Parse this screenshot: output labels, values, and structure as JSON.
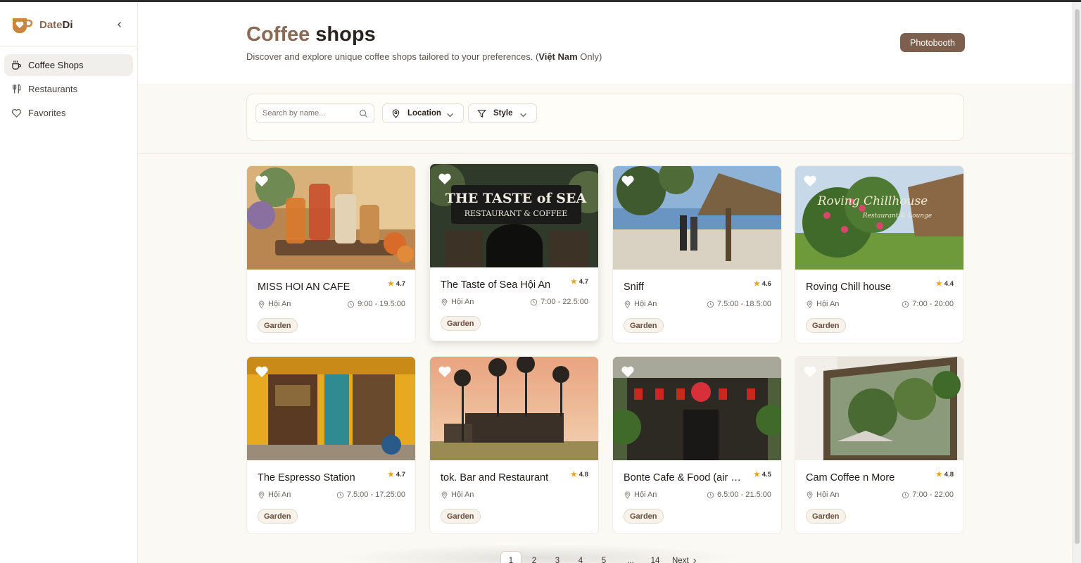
{
  "app": {
    "name_prefix": "Date",
    "name_suffix": "Di"
  },
  "sidebar": {
    "items": [
      {
        "label": "Coffee Shops",
        "icon": "coffee-cup-icon",
        "active": true
      },
      {
        "label": "Restaurants",
        "icon": "utensils-icon",
        "active": false
      },
      {
        "label": "Favorites",
        "icon": "heart-outline-icon",
        "active": false
      }
    ]
  },
  "header": {
    "title_accent": "Coffee",
    "title_rest": " shops",
    "subtitle_pre": "Discover and explore unique coffee shops tailored to your preferences. (",
    "subtitle_bold": "Việt Nam",
    "subtitle_post": " Only)",
    "photobooth_label": "Photobooth"
  },
  "filters": {
    "search_placeholder": "Search by name...",
    "search_value": "",
    "location_label": "Location",
    "style_label": "Style"
  },
  "colors": {
    "accent": "#7d5f4d",
    "star": "#e8a317",
    "tag_text": "#6b4d3b"
  },
  "cards": [
    {
      "name": "MISS HOI AN CAFE",
      "rating": "4.7",
      "location": "Hội An",
      "hours": "9:00 - 19.5:00",
      "tag": "Garden"
    },
    {
      "name": "The Taste of Sea Hội An",
      "rating": "4.7",
      "location": "Hội An",
      "hours": "7:00 - 22.5:00",
      "tag": "Garden"
    },
    {
      "name": "Sniff",
      "rating": "4.6",
      "location": "Hội An",
      "hours": "7.5:00 - 18.5:00",
      "tag": "Garden"
    },
    {
      "name": "Roving Chill house",
      "rating": "4.4",
      "location": "Hội An",
      "hours": "7:00 - 20:00",
      "tag": "Garden"
    },
    {
      "name": "The Espresso Station",
      "rating": "4.7",
      "location": "Hội An",
      "hours": "7.5:00 - 17.25:00",
      "tag": "Garden"
    },
    {
      "name": "tok. Bar and Restaurant",
      "rating": "4.8",
      "location": "Hội An",
      "hours": "",
      "tag": "Garden"
    },
    {
      "name": "Bonte Cafe & Food (air co...",
      "rating": "4.5",
      "location": "Hội An",
      "hours": "6.5:00 - 21.5:00",
      "tag": "Garden"
    },
    {
      "name": "Cam Coffee n More",
      "rating": "4.8",
      "location": "Hội An",
      "hours": "7:00 - 22:00",
      "tag": "Garden"
    }
  ],
  "image_texts": {
    "taste_sign_1": "THE TASTE of SEA",
    "taste_sign_2": "RESTAURANT & COFFEE",
    "roving_sign_1": "Roving Chillhouse",
    "roving_sign_2": "Restaurant & Lounge"
  },
  "pagination": {
    "pages": [
      "1",
      "2",
      "3",
      "4",
      "5"
    ],
    "ellipsis": "...",
    "last": "14",
    "next_label": "Next",
    "current": "1"
  }
}
